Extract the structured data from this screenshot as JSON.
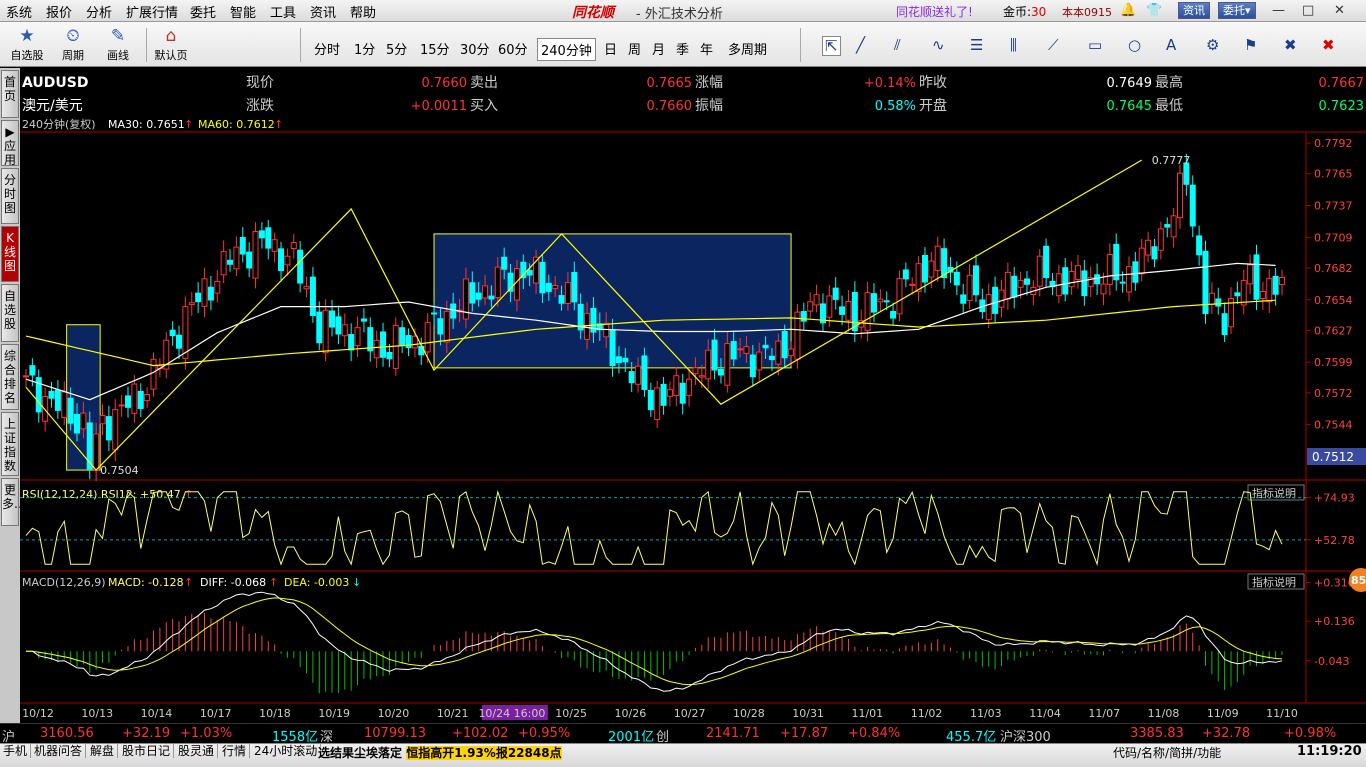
{
  "menubar": {
    "items": [
      "系统",
      "报价",
      "分析",
      "扩展行情",
      "委托",
      "智能",
      "工具",
      "资讯",
      "帮助"
    ],
    "brand": "同花顺",
    "title": "- 外汇技术分析",
    "promo": "同花顺送礼了!",
    "coins_label": "金币:",
    "coins_value": "30",
    "version": "本本0915",
    "btn_news": "资讯",
    "btn_trade": "委托▾",
    "win_min": "—",
    "win_max": "□",
    "win_close": "✕"
  },
  "toolbar": {
    "big_buttons": [
      {
        "label": "自选股",
        "icon": "★"
      },
      {
        "label": "周期",
        "icon": "⏲"
      },
      {
        "label": "画线",
        "icon": "✎"
      },
      {
        "label": "默认页",
        "icon": "⌂"
      }
    ],
    "periods": [
      "分时",
      "1分",
      "5分",
      "15分",
      "30分",
      "60分",
      "240分钟",
      "日",
      "周",
      "月",
      "季",
      "年",
      "多周期"
    ],
    "selected_period": "240分钟",
    "tools": [
      "⇱",
      "╱",
      "⫽",
      "∿",
      "☰",
      "⫼",
      "⟋",
      "▭",
      "○",
      "A",
      "⚙",
      "⚑",
      "✖"
    ]
  },
  "sidetabs": [
    {
      "label": "首页",
      "active": false
    },
    {
      "label": "▶应用",
      "active": false
    },
    {
      "label": "分时图",
      "active": false
    },
    {
      "label": "K线图",
      "active": true
    },
    {
      "label": "自选股",
      "active": false
    },
    {
      "label": "综合排名",
      "active": false
    },
    {
      "label": "上证指数",
      "active": false
    },
    {
      "label": "更多…",
      "active": false
    }
  ],
  "quote": {
    "symbol": "AUDUSD",
    "name": "澳元/美元",
    "row1": [
      {
        "label": "现价",
        "value": "0.7660"
      },
      {
        "label": "卖出",
        "value": "0.7665"
      },
      {
        "label": "涨幅",
        "value": "+0.14%"
      },
      {
        "label": "昨收",
        "value": "0.7649"
      },
      {
        "label": "最高",
        "value": "0.7667"
      }
    ],
    "row2": [
      {
        "label": "涨跌",
        "value": "+0.0011"
      },
      {
        "label": "买入",
        "value": "0.7660"
      },
      {
        "label": "振幅",
        "value": "0.58%"
      },
      {
        "label": "开盘",
        "value": "0.7645"
      },
      {
        "label": "最低",
        "value": "0.7623"
      }
    ]
  },
  "indicators": {
    "main_period": "240分钟(复权)",
    "ma30": "MA30: 0.7651",
    "ma60": "MA60: 0.7612",
    "rsi": "RSI(12,12,24) RSI12: +50.47",
    "macd_name": "MACD(12,26,9)",
    "macd": "MACD: -0.128",
    "diff": "DIFF: -0.068",
    "dea": "DEA: -0.003",
    "explain": "指标说明",
    "badge": "85"
  },
  "annotations": {
    "low": "0.7504",
    "high": "0.7777"
  },
  "current_price_tag": "0.7512",
  "colors": {
    "up": "#ff3232",
    "down": "#00ffff",
    "ma30": "#ffffff",
    "ma60": "#ffff00",
    "trend": "#ffff00",
    "box_fill": "#0a2560",
    "macd_pos": "#ff4040",
    "macd_neg": "#00c000",
    "axis": "#b00000"
  },
  "chart_data": [
    {
      "type": "candlestick",
      "title": "AUDUSD 240分钟",
      "y_ticks": [
        "0.7792",
        "0.7765",
        "0.7737",
        "0.7709",
        "0.7682",
        "0.7654",
        "0.7627",
        "0.7599",
        "0.7572",
        "0.7544"
      ],
      "ylim": [
        0.7497,
        0.78
      ],
      "x_ticks": [
        "10/12",
        "10/13",
        "10/14",
        "10/17",
        "10/18",
        "10/19",
        "10/20",
        "10/21",
        "10/24 16:00",
        "10/25",
        "10/26",
        "10/27",
        "10/28",
        "10/31",
        "11/01",
        "11/02",
        "11/03",
        "11/04",
        "11/07",
        "11/08",
        "11/09",
        "11/10"
      ],
      "x_highlight": "10-24 16:00",
      "anchors": [
        [
          0,
          0.758
        ],
        [
          9,
          0.7545
        ],
        [
          10,
          0.751
        ],
        [
          12,
          0.7545
        ],
        [
          18,
          0.757
        ],
        [
          25,
          0.764
        ],
        [
          32,
          0.769
        ],
        [
          37,
          0.7705
        ],
        [
          42,
          0.769
        ],
        [
          46,
          0.763
        ],
        [
          52,
          0.7625
        ],
        [
          56,
          0.761
        ],
        [
          62,
          0.762
        ],
        [
          68,
          0.765
        ],
        [
          74,
          0.767
        ],
        [
          78,
          0.768
        ],
        [
          84,
          0.766
        ],
        [
          90,
          0.7625
        ],
        [
          96,
          0.758
        ],
        [
          100,
          0.7565
        ],
        [
          104,
          0.7585
        ],
        [
          110,
          0.7605
        ],
        [
          118,
          0.7605
        ],
        [
          124,
          0.7655
        ],
        [
          130,
          0.764
        ],
        [
          136,
          0.7655
        ],
        [
          142,
          0.769
        ],
        [
          150,
          0.765
        ],
        [
          158,
          0.7675
        ],
        [
          166,
          0.767
        ],
        [
          174,
          0.768
        ],
        [
          180,
          0.773
        ],
        [
          182,
          0.7765
        ],
        [
          185,
          0.765
        ],
        [
          188,
          0.764
        ],
        [
          191,
          0.767
        ],
        [
          196,
          0.7665
        ],
        [
          197,
          0.766
        ]
      ],
      "ma30_anchors": [
        [
          0,
          0.7584
        ],
        [
          10,
          0.7566
        ],
        [
          20,
          0.759
        ],
        [
          30,
          0.7625
        ],
        [
          40,
          0.7648
        ],
        [
          50,
          0.7648
        ],
        [
          60,
          0.7652
        ],
        [
          70,
          0.7642
        ],
        [
          80,
          0.7636
        ],
        [
          90,
          0.7628
        ],
        [
          100,
          0.7626
        ],
        [
          110,
          0.7626
        ],
        [
          120,
          0.7628
        ],
        [
          130,
          0.7624
        ],
        [
          140,
          0.7628
        ],
        [
          150,
          0.7648
        ],
        [
          160,
          0.7665
        ],
        [
          170,
          0.7675
        ],
        [
          180,
          0.768
        ],
        [
          190,
          0.7686
        ],
        [
          197,
          0.7684
        ]
      ],
      "ma60_anchors": [
        [
          0,
          0.7622
        ],
        [
          20,
          0.7596
        ],
        [
          40,
          0.7606
        ],
        [
          60,
          0.7614
        ],
        [
          80,
          0.7628
        ],
        [
          100,
          0.7636
        ],
        [
          120,
          0.7638
        ],
        [
          140,
          0.763
        ],
        [
          160,
          0.7636
        ],
        [
          180,
          0.7648
        ],
        [
          197,
          0.7654
        ]
      ],
      "box_left": {
        "x": [
          7,
          11
        ],
        "y": [
          0.7504,
          0.7632
        ]
      },
      "box_mid": {
        "x": [
          64,
          120
        ],
        "y": [
          0.7594,
          0.7712
        ]
      },
      "trend_lines": [
        [
          [
            0,
            0.7577
          ],
          [
            11,
            0.7504
          ],
          [
            51,
            0.7734
          ],
          [
            64,
            0.7592
          ],
          [
            84,
            0.7712
          ],
          [
            109,
            0.7562
          ],
          [
            175,
            0.7777
          ]
        ]
      ]
    },
    {
      "type": "line",
      "title": "RSI(12,12,24)",
      "y_ticks": [
        "+74.93",
        "+52.78"
      ],
      "ylim": [
        38,
        80
      ],
      "rsi12_last": 50.47,
      "reference_lines": [
        74.93,
        52.78
      ]
    },
    {
      "type": "bar",
      "title": "MACD(12,26,9)",
      "y_ticks": [
        "+0.310",
        "+0.136",
        "-0.043"
      ],
      "ylim": [
        -0.22,
        0.34
      ],
      "macd_last": -0.128,
      "diff_last": -0.068,
      "dea_last": -0.003
    }
  ],
  "marquee": [
    {
      "label": "沪",
      "value": "3160.56",
      "chg": "+32.19",
      "pct": "+1.03%",
      "vol": "1558亿"
    },
    {
      "label": "深",
      "value": "10799.13",
      "chg": "+102.02",
      "pct": "+0.95%",
      "vol": "2001亿"
    },
    {
      "label": "创",
      "value": "2141.71",
      "chg": "+17.87",
      "pct": "+0.84%",
      "vol": "455.7亿"
    },
    {
      "label": "沪深300",
      "value": "3385.83",
      "chg": "+32.78",
      "pct": "+0.98%",
      "vol": ""
    }
  ],
  "statusbar": {
    "items": [
      "手机",
      "机器问答",
      "解盘",
      "股市日记",
      "股灵通",
      "行情",
      "24小时滚动"
    ],
    "notice_prefix": "选结果尘埃落定",
    "notice_hot": "恒指高开1.93%报22848点",
    "right": "代码/名称/简拼/功能",
    "clock": "11:19:20"
  }
}
